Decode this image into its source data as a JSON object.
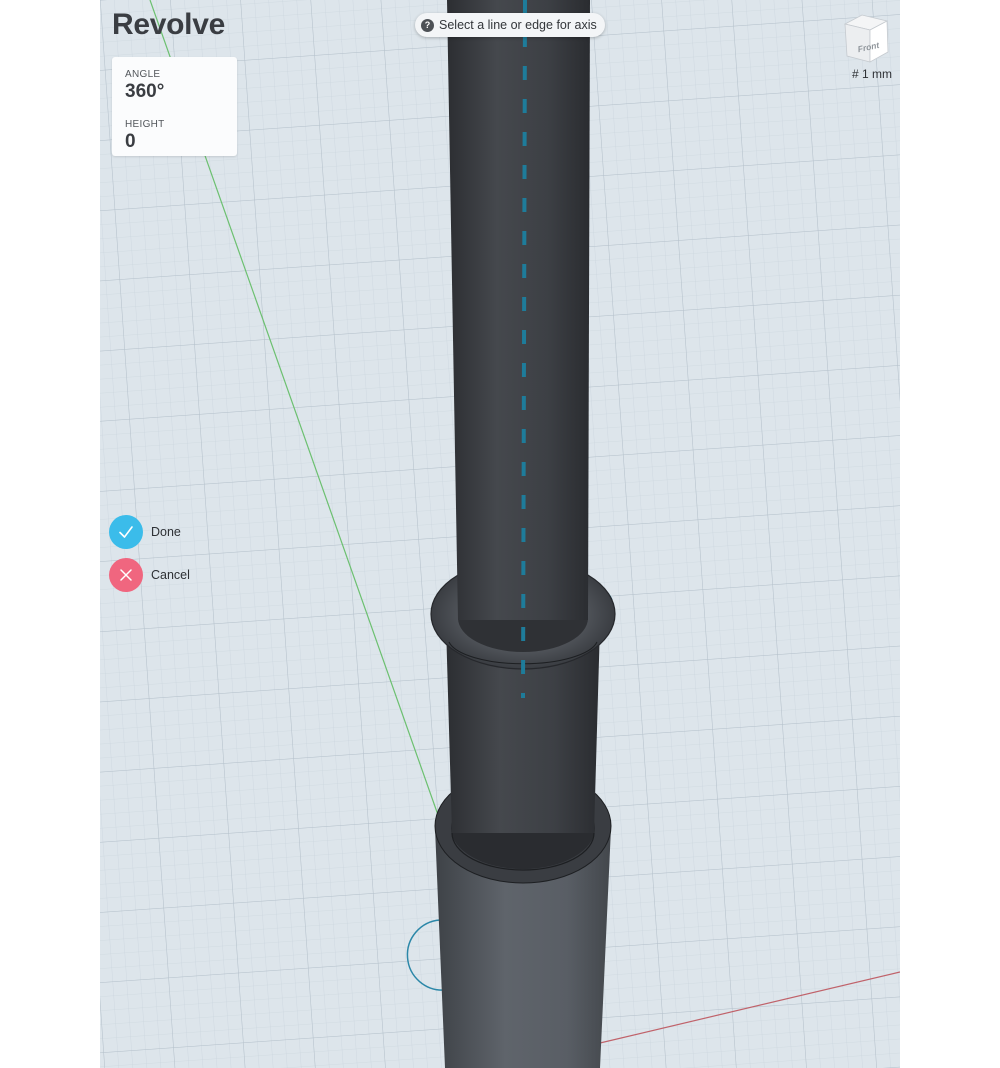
{
  "tool": {
    "title": "Revolve",
    "hint": "Select a line or edge for axis",
    "hint_icon": "question-icon"
  },
  "params": {
    "angle_label": "ANGLE",
    "angle_value": "360°",
    "height_label": "HEIGHT",
    "height_value": "0"
  },
  "actions": {
    "done_label": "Done",
    "done_color": "#3bbcea",
    "cancel_label": "Cancel",
    "cancel_color": "#f0667f"
  },
  "view_cube": {
    "face_label": "Front"
  },
  "grid": {
    "unit_label": "# 1 mm"
  },
  "colors": {
    "axis_highlight": "#1e7c9a",
    "y_axis_line": "#6cc070",
    "x_axis_line": "#c0626a",
    "body_dark": "#3b3e43",
    "body_light": "#585d64"
  }
}
